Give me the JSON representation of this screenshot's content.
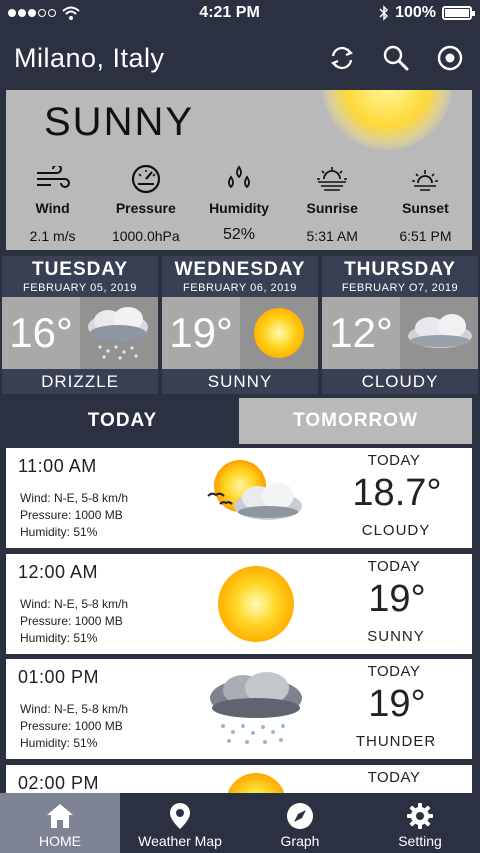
{
  "status": {
    "time": "4:21 PM",
    "battery": "100%",
    "battery_level": 1.0
  },
  "header": {
    "city": "Milano, Italy"
  },
  "current": {
    "condition": "SUNNY",
    "metrics": [
      {
        "label": "Wind",
        "value": "2.1 m/s",
        "icon": "wind-icon"
      },
      {
        "label": "Pressure",
        "value": "1000.0hPa",
        "icon": "gauge-icon"
      },
      {
        "label": "Humidity",
        "value": "52%",
        "icon": "droplets-icon"
      },
      {
        "label": "Sunrise",
        "value": "5:31 AM",
        "icon": "sunrise-icon"
      },
      {
        "label": "Sunset",
        "value": "6:51 PM",
        "icon": "sunset-icon"
      }
    ]
  },
  "days": [
    {
      "name": "TUESDAY",
      "date": "FEBRUARY 05, 2019",
      "temp": "16°",
      "condition": "DRIZZLE",
      "icon": "rain-cloud-icon"
    },
    {
      "name": "WEDNESDAY",
      "date": "FEBRUARY 06, 2019",
      "temp": "19°",
      "condition": "SUNNY",
      "icon": "sun-icon"
    },
    {
      "name": "THURSDAY",
      "date": "FEBRUARY O7, 2019",
      "temp": "12°",
      "condition": "CLOUDY",
      "icon": "cloud-icon"
    }
  ],
  "tabs": {
    "today": "TODAY",
    "tomorrow": "TOMORROW"
  },
  "hours": [
    {
      "time": "11:00 AM",
      "wind": "Wind: N-E, 5-8 km/h",
      "pressure": "Pressure: 1000 MB",
      "humidity": "Humidity: 51%",
      "day": "TODAY",
      "temp": "18.7°",
      "condition": "CLOUDY",
      "icon": "sun-cloud-icon"
    },
    {
      "time": "12:00 AM",
      "wind": "Wind: N-E, 5-8 km/h",
      "pressure": "Pressure: 1000 MB",
      "humidity": "Humidity: 51%",
      "day": "TODAY",
      "temp": "19°",
      "condition": "SUNNY",
      "icon": "sun-icon"
    },
    {
      "time": "01:00 PM",
      "wind": "Wind: N-E, 5-8 km/h",
      "pressure": "Pressure: 1000 MB",
      "humidity": "Humidity: 51%",
      "day": "TODAY",
      "temp": "19°",
      "condition": "THUNDER",
      "icon": "storm-cloud-icon"
    },
    {
      "time": "02:00 PM",
      "day": "TODAY",
      "icon": "sun-icon"
    }
  ],
  "nav": [
    {
      "label": "HOME",
      "icon": "home-icon"
    },
    {
      "label": "Weather Map",
      "icon": "map-pin-icon"
    },
    {
      "label": "Graph",
      "icon": "compass-icon"
    },
    {
      "label": "Setting",
      "icon": "gear-icon"
    }
  ]
}
